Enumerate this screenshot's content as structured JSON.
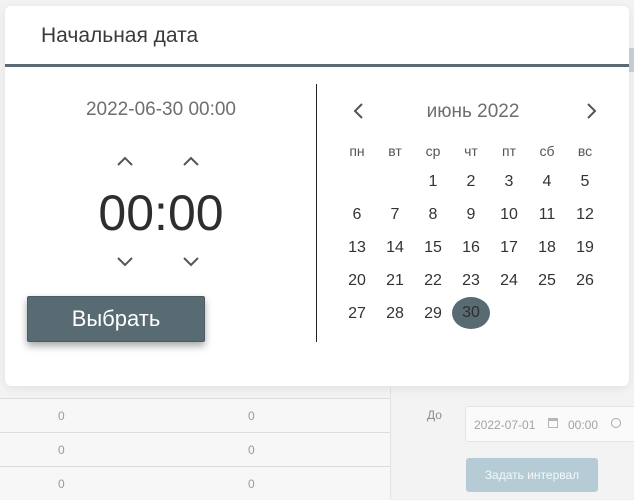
{
  "modal": {
    "title": "Начальная дата"
  },
  "time_picker": {
    "selected_datetime": "2022-06-30 00:00",
    "hours": "00",
    "separator": ":",
    "minutes": "00",
    "choose_label": "Выбрать"
  },
  "calendar": {
    "month_label": "июнь 2022",
    "weekdays": [
      "пн",
      "вт",
      "ср",
      "чт",
      "пт",
      "сб",
      "вс"
    ],
    "weeks": [
      [
        "",
        "",
        "1",
        "2",
        "3",
        "4",
        "5"
      ],
      [
        "6",
        "7",
        "8",
        "9",
        "10",
        "11",
        "12"
      ],
      [
        "13",
        "14",
        "15",
        "16",
        "17",
        "18",
        "19"
      ],
      [
        "20",
        "21",
        "22",
        "23",
        "24",
        "25",
        "26"
      ],
      [
        "27",
        "28",
        "29",
        "30",
        "",
        "",
        ""
      ]
    ],
    "selected_day": "30",
    "selected_color": "#586a72"
  },
  "background": {
    "table_rows": [
      [
        "0",
        "0"
      ],
      [
        "0",
        "0"
      ],
      [
        "0",
        "0"
      ]
    ],
    "to_label": "До",
    "to_date": "2022-07-01",
    "to_time": "00:00",
    "interval_button": "Задать интервал"
  },
  "icons": {
    "up": "chevron-up-icon",
    "down": "chevron-down-icon",
    "prev": "chevron-left-icon",
    "next": "chevron-right-icon",
    "calendar": "calendar-icon",
    "clock": "clock-icon"
  },
  "colors": {
    "accent": "#586a72",
    "interval_button": "#b5ccd6"
  }
}
